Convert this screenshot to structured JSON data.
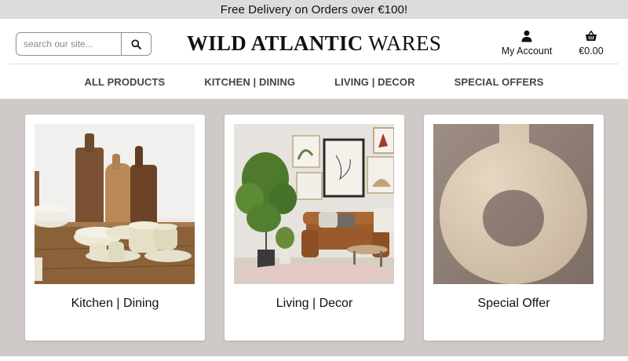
{
  "promo": {
    "text": "Free Delivery on Orders over €100!"
  },
  "search": {
    "placeholder": "search our site...",
    "value": "",
    "button_icon": "search-icon"
  },
  "brand": {
    "bold_part": "WILD ATLANTIC",
    "regular_part": "WARES"
  },
  "account": {
    "label": "My Account",
    "icon": "person-icon"
  },
  "basket": {
    "total": "€0.00",
    "icon": "basket-icon"
  },
  "nav": {
    "items": [
      {
        "label": "ALL PRODUCTS"
      },
      {
        "label": "KITCHEN | DINING"
      },
      {
        "label": "LIVING | DECOR"
      },
      {
        "label": "SPECIAL OFFERS"
      }
    ]
  },
  "categories": [
    {
      "title": "Kitchen | Dining",
      "image": "kitchenware-photo"
    },
    {
      "title": "Living | Decor",
      "image": "living-room-photo"
    },
    {
      "title": "Special Offer",
      "image": "ring-vase-photo"
    }
  ],
  "colors": {
    "promo_bg": "#dcdcdc",
    "content_bg": "#cfc9c7",
    "nav_text": "#444444"
  }
}
